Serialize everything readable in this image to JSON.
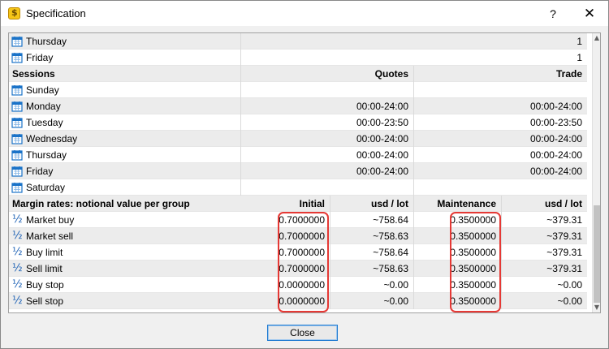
{
  "window": {
    "title": "Specification",
    "help_label": "?",
    "close_label": "✕"
  },
  "days_top": [
    {
      "label": "Thursday",
      "value": "1"
    },
    {
      "label": "Friday",
      "value": "1"
    }
  ],
  "sessions": {
    "header": {
      "label": "Sessions",
      "quotes": "Quotes",
      "trade": "Trade"
    },
    "rows": [
      {
        "label": "Sunday",
        "quotes": "",
        "trade": ""
      },
      {
        "label": "Monday",
        "quotes": "00:00-24:00",
        "trade": "00:00-24:00"
      },
      {
        "label": "Tuesday",
        "quotes": "00:00-23:50",
        "trade": "00:00-23:50"
      },
      {
        "label": "Wednesday",
        "quotes": "00:00-24:00",
        "trade": "00:00-24:00"
      },
      {
        "label": "Thursday",
        "quotes": "00:00-24:00",
        "trade": "00:00-24:00"
      },
      {
        "label": "Friday",
        "quotes": "00:00-24:00",
        "trade": "00:00-24:00"
      },
      {
        "label": "Saturday",
        "quotes": "",
        "trade": ""
      }
    ]
  },
  "margin": {
    "header": {
      "label": "Margin rates: notional value per group",
      "initial": "Initial",
      "usd_lot_1": "usd / lot",
      "maintenance": "Maintenance",
      "usd_lot_2": "usd / lot"
    },
    "rows": [
      {
        "label": "Market buy",
        "initial": "0.7000000",
        "usd1": "~758.64",
        "maintenance": "0.3500000",
        "usd2": "~379.31"
      },
      {
        "label": "Market sell",
        "initial": "0.7000000",
        "usd1": "~758.63",
        "maintenance": "0.3500000",
        "usd2": "~379.31"
      },
      {
        "label": "Buy limit",
        "initial": "0.7000000",
        "usd1": "~758.64",
        "maintenance": "0.3500000",
        "usd2": "~379.31"
      },
      {
        "label": "Sell limit",
        "initial": "0.7000000",
        "usd1": "~758.63",
        "maintenance": "0.3500000",
        "usd2": "~379.31"
      },
      {
        "label": "Buy stop",
        "initial": "0.0000000",
        "usd1": "~0.00",
        "maintenance": "0.3500000",
        "usd2": "~0.00"
      },
      {
        "label": "Sell stop",
        "initial": "0.0000000",
        "usd1": "~0.00",
        "maintenance": "0.3500000",
        "usd2": "~0.00"
      }
    ]
  },
  "icons": {
    "day": "calendar-icon",
    "margin": "fraction-half-icon"
  },
  "colors": {
    "highlight": "#e53935",
    "calendar": "#1a73c8",
    "header_bg": "#ececec"
  },
  "footer": {
    "close_label": "Close"
  }
}
